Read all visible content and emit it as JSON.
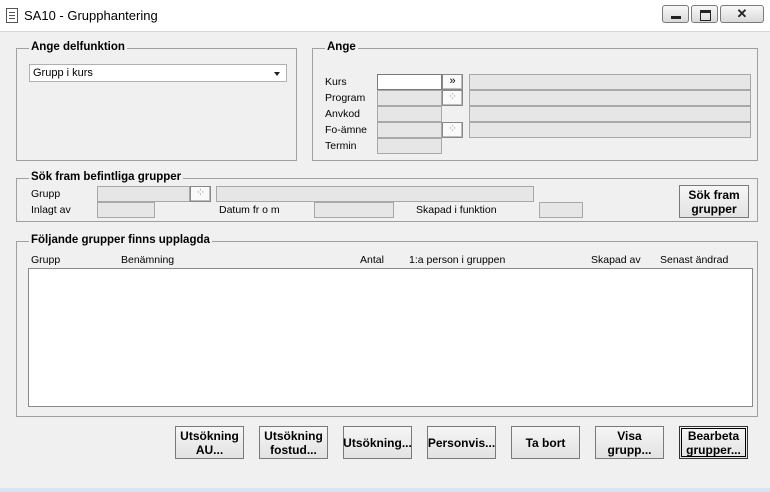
{
  "window": {
    "title": "SA10 - Grupphantering",
    "close_glyph": "✕"
  },
  "delfunktion": {
    "legend": "Ange delfunktion",
    "selected": "Grupp i kurs"
  },
  "ange": {
    "legend": "Ange",
    "kurs_label": "Kurs",
    "kurs_btn": "»",
    "program_label": "Program",
    "program_btn": "⁘",
    "anvkod_label": "Anvkod",
    "foamne_label": "Fo-ämne",
    "foamne_btn": "⁘",
    "termin_label": "Termin"
  },
  "sok": {
    "legend": "Sök fram befintliga grupper",
    "grupp_label": "Grupp",
    "grupp_btn": "⁘",
    "inlagt_label": "Inlagt av",
    "datum_label": "Datum fr o m",
    "skapad_label": "Skapad i funktion",
    "search_button": "Sök fram\ngrupper"
  },
  "list": {
    "legend": "Följande grupper finns upplagda",
    "columns": [
      "Grupp",
      "Benämning",
      "Antal",
      "1:a person i gruppen",
      "Skapad av",
      "Senast ändrad"
    ]
  },
  "actions": {
    "utsokning_au": "Utsökning\nAU...",
    "utsokning_fostud": "Utsökning\nfostud...",
    "utsokning": "Utsökning...",
    "personvis": "Personvis...",
    "ta_bort": "Ta bort",
    "visa_grupp": "Visa\ngrupp...",
    "bearbeta": "Bearbeta\ngrupper..."
  }
}
